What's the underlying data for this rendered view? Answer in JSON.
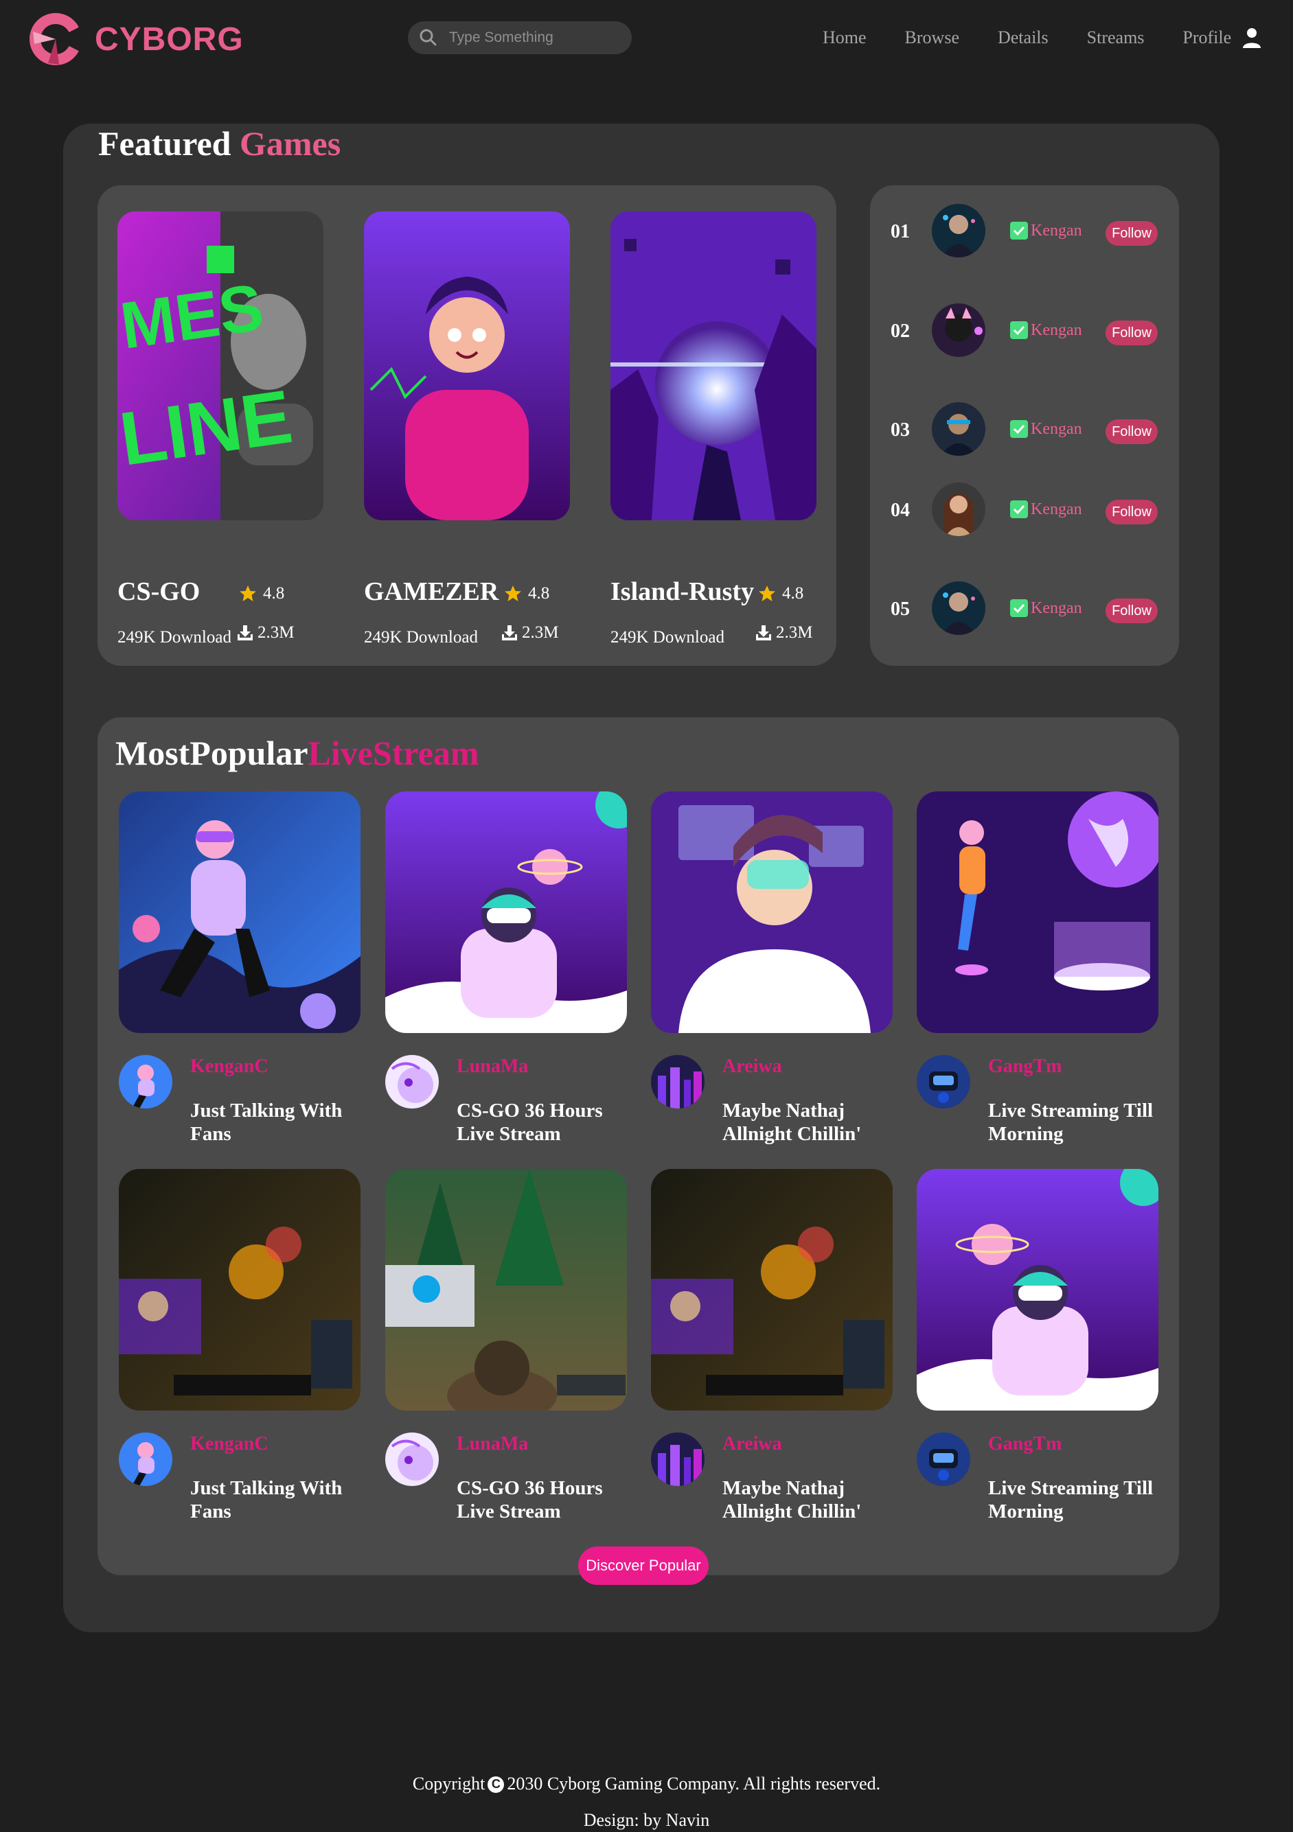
{
  "brand": {
    "name": "CYBORG"
  },
  "search": {
    "placeholder": "Type Something"
  },
  "nav": {
    "items": [
      "Home",
      "Browse",
      "Details",
      "Streams",
      "Profile"
    ]
  },
  "featured": {
    "heading_main": "Featured",
    "heading_accent": "Games",
    "games": [
      {
        "name": "CS-GO",
        "rating": "4.8",
        "downloads": "249K Download",
        "count": "2.3M"
      },
      {
        "name": "GAMEZER",
        "rating": "4.8",
        "downloads": "249K Download",
        "count": "2.3M"
      },
      {
        "name": "Island-Rusty",
        "rating": "4.8",
        "downloads": "249K Download",
        "count": "2.3M"
      }
    ]
  },
  "top_streamers": [
    {
      "rank": "01",
      "name": "Kengan",
      "button": "Follow"
    },
    {
      "rank": "02",
      "name": "Kengan",
      "button": "Follow"
    },
    {
      "rank": "03",
      "name": "Kengan",
      "button": "Follow"
    },
    {
      "rank": "04",
      "name": "Kengan",
      "button": "Follow"
    },
    {
      "rank": "05",
      "name": "Kengan",
      "button": "Follow"
    }
  ],
  "popular": {
    "heading_main": "MostPopular",
    "heading_accent": "LiveStream",
    "streams": [
      {
        "streamer": "KenganC",
        "title": "Just Talking With Fans"
      },
      {
        "streamer": "LunaMa",
        "title": "CS-GO 36 Hours Live Stream"
      },
      {
        "streamer": "Areiwa",
        "title": "Maybe Nathaj Allnight Chillin'"
      },
      {
        "streamer": "GangTm",
        "title": "Live Streaming Till Morning"
      },
      {
        "streamer": "KenganC",
        "title": "Just Talking With Fans"
      },
      {
        "streamer": "LunaMa",
        "title": "CS-GO 36 Hours Live Stream"
      },
      {
        "streamer": "Areiwa",
        "title": "Maybe Nathaj Allnight Chillin'"
      },
      {
        "streamer": "GangTm",
        "title": "Live Streaming Till Morning"
      }
    ],
    "button": "Discover Popular"
  },
  "footer": {
    "copyright_prefix": "Copyright",
    "copyright_symbol": "C",
    "copyright_text": "2030 Cyborg Gaming Company. All rights reserved.",
    "design": "Design: by Navin"
  },
  "colors": {
    "accent": "#e75e8d",
    "pink_button": "#ec1b8c",
    "follow": "#c33b63",
    "panel": "#333333",
    "card": "#4a4a4a"
  },
  "icons": [
    "search-icon",
    "user-icon",
    "star-icon",
    "download-icon",
    "check-icon",
    "copyright-icon"
  ]
}
